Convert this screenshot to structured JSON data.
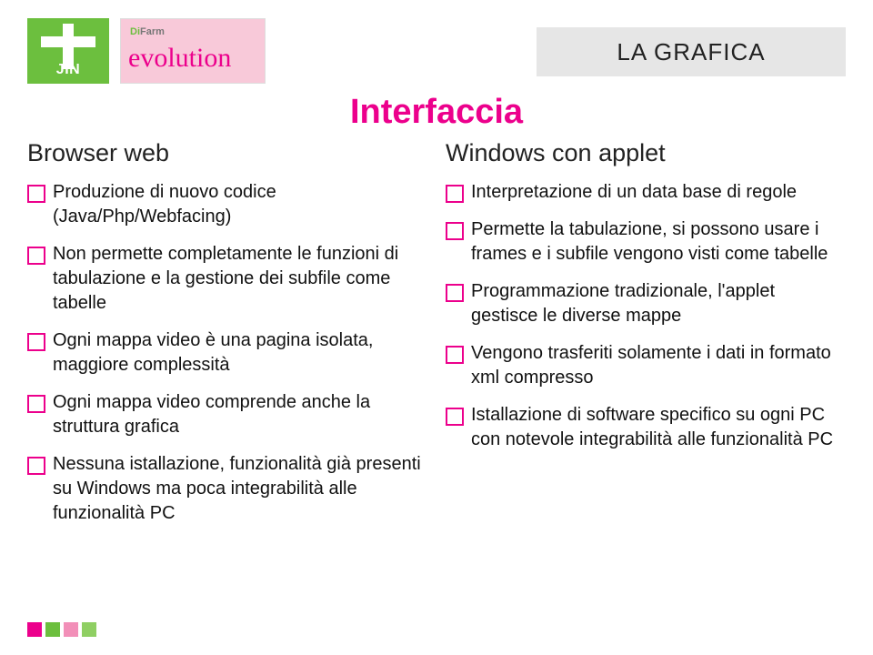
{
  "logos": {
    "jin_text": "JIN",
    "evo_brand_prefix": "Di",
    "evo_brand_suffix": "Farm",
    "evo_script": "evolution"
  },
  "tag": "LA GRAFICA",
  "title": "Interfaccia",
  "left": {
    "heading": "Browser web",
    "items": [
      "Produzione di nuovo codice (Java/Php/Webfacing)",
      "Non permette completamente le funzioni di tabulazione e la gestione dei subfile come tabelle",
      "Ogni mappa video è una pagina isolata, maggiore complessità",
      "Ogni mappa video comprende anche la struttura grafica",
      "Nessuna istallazione, funzionalità già presenti su Windows ma poca integrabilità alle funzionalità PC"
    ]
  },
  "right": {
    "heading": "Windows con applet",
    "items": [
      "Interpretazione di un data base di regole",
      "Permette la tabulazione, si possono usare i frames e i subfile vengono visti come tabelle",
      "Programmazione tradizionale, l'applet gestisce le diverse mappe",
      "Vengono trasferiti solamente i dati in formato xml compresso",
      "Istallazione di software specifico su ogni PC con notevole integrabilità alle funzionalità PC"
    ]
  }
}
